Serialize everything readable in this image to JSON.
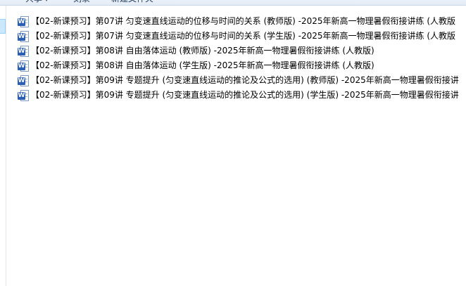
{
  "toolbar": {
    "share_label": "共享",
    "burn_label": "刻录",
    "new_folder_label": "新建文件夹"
  },
  "files": [
    {
      "icon": "word-doc-icon",
      "icon_letter": "W",
      "name": "【02-新课预习】第07讲  匀变速直线运动的位移与时间的关系 (教师版) -2025年新高一物理暑假衔接讲练 (人教版"
    },
    {
      "icon": "word-doc-icon",
      "icon_letter": "W",
      "name": "【02-新课预习】第07讲  匀变速直线运动的位移与时间的关系 (学生版) -2025年新高一物理暑假衔接讲练 (人教版"
    },
    {
      "icon": "word-doc-icon",
      "icon_letter": "W",
      "name": "【02-新课预习】第08讲  自由落体运动 (教师版) -2025年新高一物理暑假衔接讲练 (人教版)"
    },
    {
      "icon": "word-doc-icon",
      "icon_letter": "W",
      "name": "【02-新课预习】第08讲  自由落体运动 (学生版) -2025年新高一物理暑假衔接讲练 (人教版)"
    },
    {
      "icon": "word-doc-icon",
      "icon_letter": "W",
      "name": "【02-新课预习】第09讲  专题提升 (匀变速直线运动的推论及公式的选用) (教师版) -2025年新高一物理暑假衔接讲"
    },
    {
      "icon": "word-doc-icon",
      "icon_letter": "W",
      "name": "【02-新课预习】第09讲  专题提升 (匀变速直线运动的推论及公式的选用) (学生版) -2025年新高一物理暑假衔接讲"
    }
  ]
}
